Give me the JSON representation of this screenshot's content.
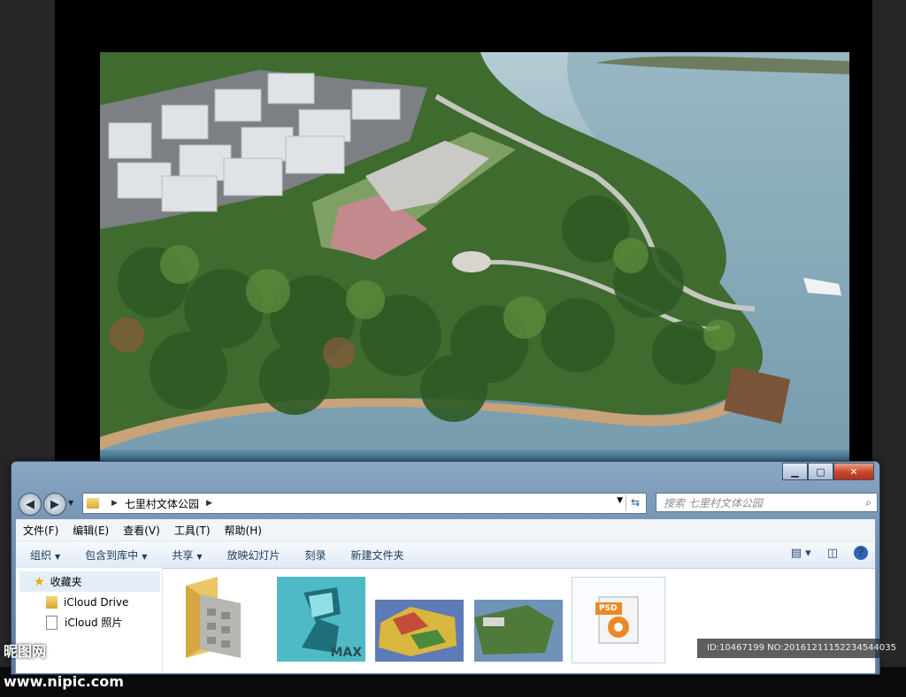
{
  "window": {
    "address_segments": [
      "七里村文体公园"
    ],
    "search_placeholder": "搜索 七里村文体公园",
    "caption": {
      "minimize": "▭",
      "maximize": "▢",
      "close": "✕"
    }
  },
  "menu": [
    "文件(F)",
    "编辑(E)",
    "查看(V)",
    "工具(T)",
    "帮助(H)"
  ],
  "toolbar": {
    "organize": "组织",
    "include_library": "包含到库中",
    "share": "共享",
    "slideshow": "放映幻灯片",
    "burn": "刻录",
    "new_folder": "新建文件夹"
  },
  "nav_pane": {
    "favorites": "收藏夹",
    "items": [
      "iCloud Drive",
      "iCloud 照片"
    ]
  },
  "files": [
    {
      "name": "folder-thumb",
      "label": ""
    },
    {
      "name": "3dsmax-file",
      "label": "MAX"
    },
    {
      "name": "plan-image-1",
      "label": ""
    },
    {
      "name": "plan-image-2",
      "label": ""
    },
    {
      "name": "psd-file",
      "label": "PSD"
    }
  ],
  "watermark": {
    "left": "昵图网 www.nipic.com",
    "right": "ID:10467199 NO:20161211152234544035"
  },
  "colors": {
    "accent": "#2b64b8",
    "water": "#7fa3b3",
    "roof": "#e4e7ea"
  }
}
